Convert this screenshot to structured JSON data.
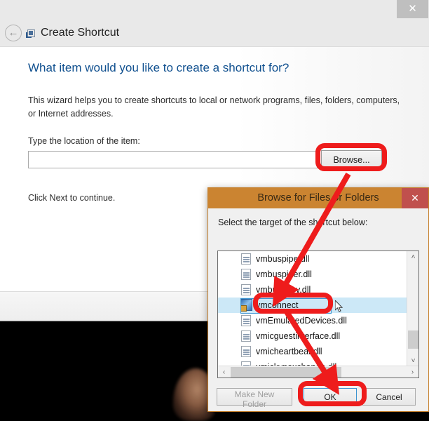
{
  "wizard": {
    "title": "Create Shortcut",
    "title_icon": "shortcut-icon",
    "close_label": "✕",
    "back_label": "←",
    "heading": "What item would you like to create a shortcut for?",
    "paragraph": "This wizard helps you to create shortcuts to local or network programs, files, folders, computers, or Internet addresses.",
    "location_label": "Type the location of the item:",
    "location_value": "",
    "location_placeholder": "",
    "browse_label": "Browse...",
    "next_hint": "Click Next to continue."
  },
  "browse_dialog": {
    "title": "Browse for Files or Folders",
    "close_label": "✕",
    "subtitle": "Select the target of the shortcut below:",
    "items": [
      {
        "name": "vmbuspipe.dll",
        "icon": "dll-file-icon",
        "selected": false
      },
      {
        "name": "vmbuspiper.dll",
        "icon": "dll-file-icon",
        "selected": false
      },
      {
        "name": "vmbusvdev.dll",
        "icon": "dll-file-icon",
        "selected": false
      },
      {
        "name": "vmconnect",
        "icon": "exe-app-icon",
        "selected": true
      },
      {
        "name": "vmEmulatedDevices.dll",
        "icon": "dll-file-icon",
        "selected": false
      },
      {
        "name": "vmicguestinterface.dll",
        "icon": "dll-file-icon",
        "selected": false
      },
      {
        "name": "vmicheartbeat.dll",
        "icon": "dll-file-icon",
        "selected": false
      },
      {
        "name": "vmickvpexchange.dll",
        "icon": "dll-file-icon",
        "selected": false
      }
    ],
    "scroll_up_label": "˄",
    "scroll_down_label": "˅",
    "scroll_left_label": "‹",
    "scroll_right_label": "›",
    "make_new_folder_label": "Make New Folder",
    "ok_label": "OK",
    "cancel_label": "Cancel"
  },
  "annotations": {
    "accent_color": "#ee1c1c",
    "highlight_browse": "Browse...",
    "highlight_item": "vmconnect",
    "highlight_ok": "OK"
  },
  "colors": {
    "wizard_heading": "#10508f",
    "dialog_titlebar": "#cb8431",
    "dialog_close": "#c0504d",
    "selection": "#cce8f7",
    "annotation_red": "#ee1c1c"
  }
}
